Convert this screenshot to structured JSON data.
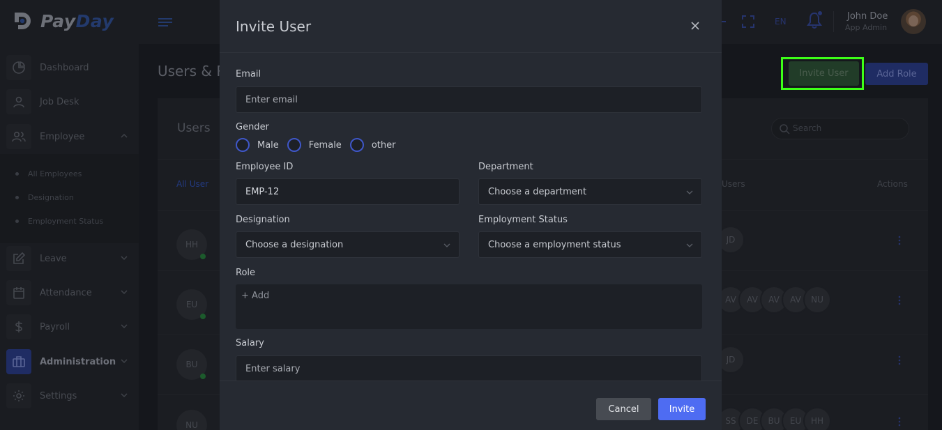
{
  "brand": {
    "name_part1": "Pay",
    "name_part2": "Day"
  },
  "header": {
    "language": "EN",
    "user_name": "John Doe",
    "user_role": "App Admin"
  },
  "sidebar": {
    "items": [
      {
        "label": "Dashboard",
        "icon": "pie-chart-icon"
      },
      {
        "label": "Job Desk",
        "icon": "person-icon"
      },
      {
        "label": "Employee",
        "icon": "users-icon",
        "expanded": true
      },
      {
        "label": "Leave",
        "icon": "edit-icon"
      },
      {
        "label": "Attendance",
        "icon": "calendar-icon"
      },
      {
        "label": "Payroll",
        "icon": "dollar-icon"
      },
      {
        "label": "Administration",
        "icon": "briefcase-icon",
        "active": true
      },
      {
        "label": "Settings",
        "icon": "gear-icon"
      }
    ],
    "employee_sub": [
      "All Employees",
      "Designation",
      "Employment Status"
    ]
  },
  "page": {
    "title": "Users & Roles",
    "invite_button": "Invite User",
    "add_role_button": "Add Role",
    "card_title": "Users",
    "search_placeholder": "Search",
    "tab_all_user": "All User",
    "col_users": "Users",
    "col_actions": "Actions",
    "rows": [
      {
        "initials": "HH",
        "users": [
          "JD"
        ]
      },
      {
        "initials": "EU",
        "users": [
          "AV",
          "AV",
          "AV",
          "AV",
          "NU"
        ]
      },
      {
        "initials": "BU",
        "users": [
          "JD"
        ]
      },
      {
        "initials": "NU",
        "users": [
          "SS",
          "DE",
          "BU",
          "EU",
          "HH"
        ]
      }
    ]
  },
  "modal": {
    "title": "Invite User",
    "email_label": "Email",
    "email_placeholder": "Enter email",
    "gender_label": "Gender",
    "gender_options": [
      "Male",
      "Female",
      "other"
    ],
    "employee_id_label": "Employee ID",
    "employee_id_value": "EMP-12",
    "department_label": "Department",
    "department_value": "Choose a department",
    "designation_label": "Designation",
    "designation_value": "Choose a designation",
    "employment_status_label": "Employment Status",
    "employment_status_value": "Choose a employment status",
    "role_label": "Role",
    "role_add": "+ Add",
    "salary_label": "Salary",
    "salary_placeholder": "Enter salary",
    "cancel_button": "Cancel",
    "invite_button": "Invite"
  },
  "colors": {
    "accent": "#4e6cf2",
    "highlight": "#3dff18",
    "modal_bg": "#262a32"
  }
}
